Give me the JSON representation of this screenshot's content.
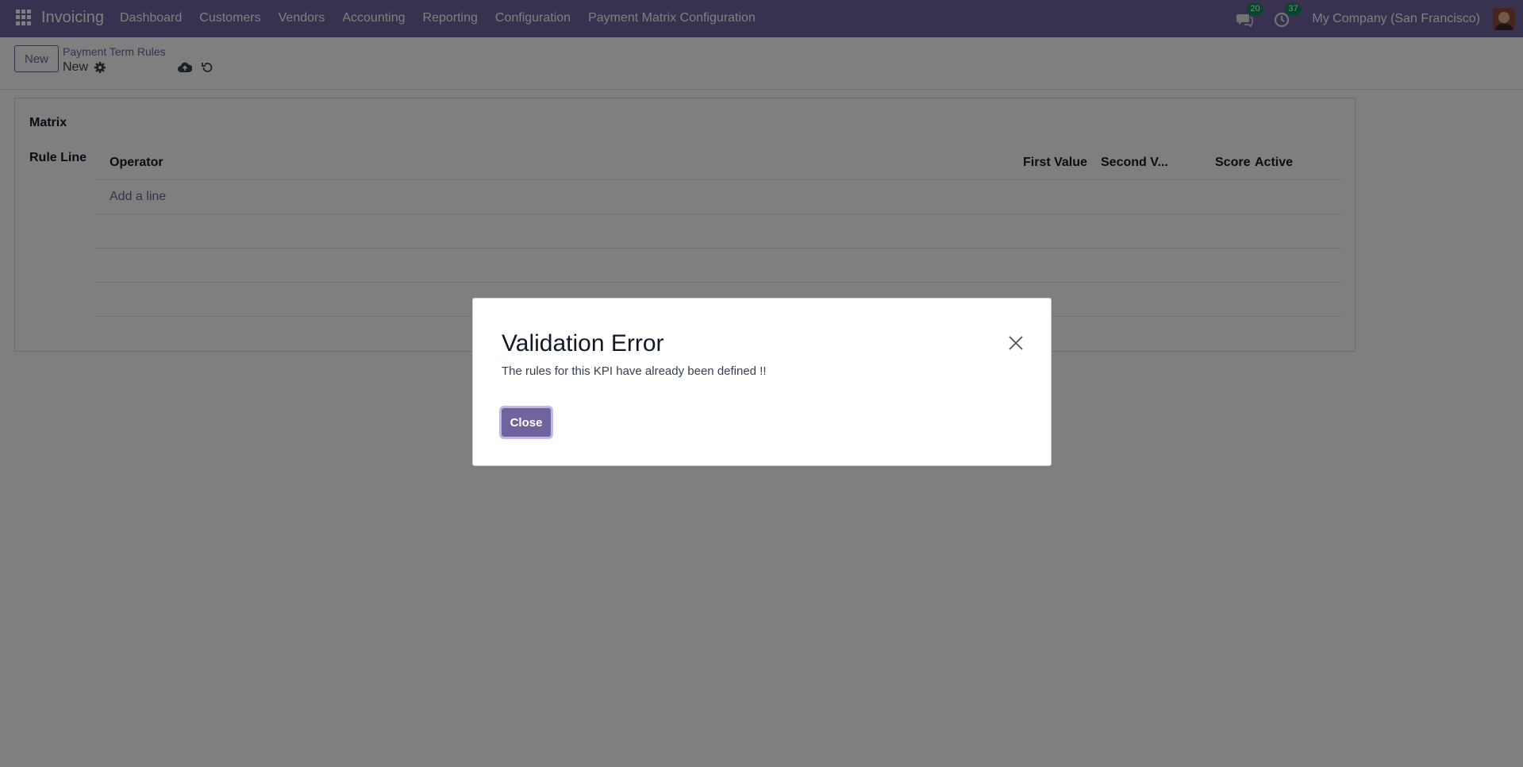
{
  "navbar": {
    "app_name": "Invoicing",
    "menu": [
      "Dashboard",
      "Customers",
      "Vendors",
      "Accounting",
      "Reporting",
      "Configuration",
      "Payment Matrix Configuration"
    ],
    "messages_count": "20",
    "activities_count": "37",
    "company": "My Company (San Francisco)",
    "brand_color": "#71639e"
  },
  "control": {
    "new_label": "New",
    "breadcrumb": "Payment Term Rules",
    "record_name": "New"
  },
  "form": {
    "matrix_label": "Matrix",
    "rule_line_label": "Rule Line",
    "columns": [
      "Operator",
      "First Value",
      "Second V...",
      "Score",
      "Active"
    ],
    "add_line": "Add a line"
  },
  "dialog": {
    "title": "Validation Error",
    "message": "The rules for this KPI have already been defined !!",
    "close_label": "Close"
  }
}
